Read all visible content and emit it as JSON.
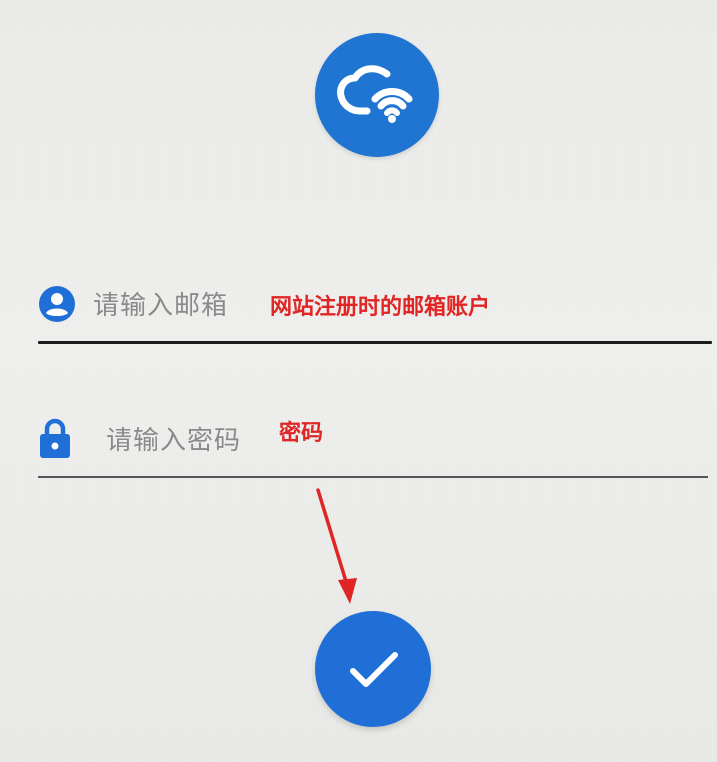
{
  "app": {
    "logo_icon": "cloud-wifi-icon",
    "accent_color": "#1f75d1"
  },
  "login_form": {
    "email_placeholder": "请输入邮箱",
    "email_icon": "account-circle-icon",
    "password_placeholder": "请输入密码",
    "password_icon": "lock-icon",
    "submit_icon": "check-icon"
  },
  "annotations": {
    "email_note": "网站注册时的邮箱账户",
    "password_note": "密码",
    "arrow_icon": "red-arrow-icon",
    "color": "#e02525"
  }
}
